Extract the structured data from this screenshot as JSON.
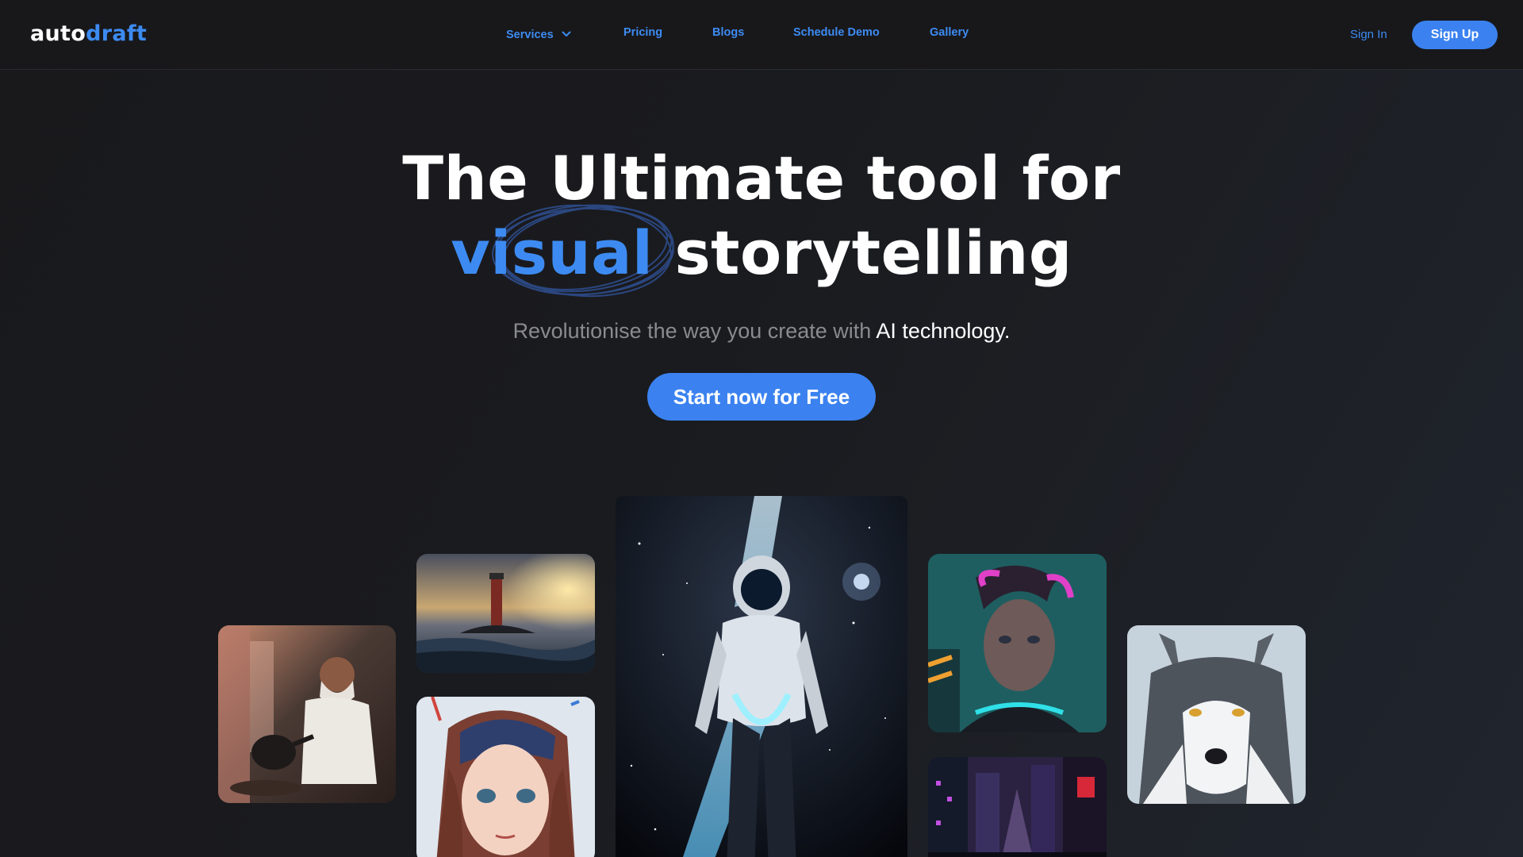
{
  "brand": {
    "logo_part1": "auto",
    "logo_part2": "draft",
    "accent_color": "#3d8bf2"
  },
  "nav": {
    "items": [
      {
        "label": "Services",
        "has_dropdown": true
      },
      {
        "label": "Pricing"
      },
      {
        "label": "Blogs"
      },
      {
        "label": "Schedule Demo"
      },
      {
        "label": "Gallery"
      }
    ],
    "sign_in": "Sign In",
    "sign_up": "Sign Up"
  },
  "hero": {
    "title_line1": "The Ultimate tool for",
    "title_accent": "visual",
    "title_rest": " storytelling",
    "subtitle_muted": "Revolutionise the way you create with ",
    "subtitle_highlight": "AI technology.",
    "cta_label": "Start now for Free"
  },
  "gallery": {
    "images": [
      {
        "name": "old-man-teapot-image"
      },
      {
        "name": "lighthouse-image"
      },
      {
        "name": "anime-girl-image"
      },
      {
        "name": "astronaut-image"
      },
      {
        "name": "cyberpunk-man-image"
      },
      {
        "name": "neon-city-image"
      },
      {
        "name": "wolf-image"
      }
    ]
  }
}
